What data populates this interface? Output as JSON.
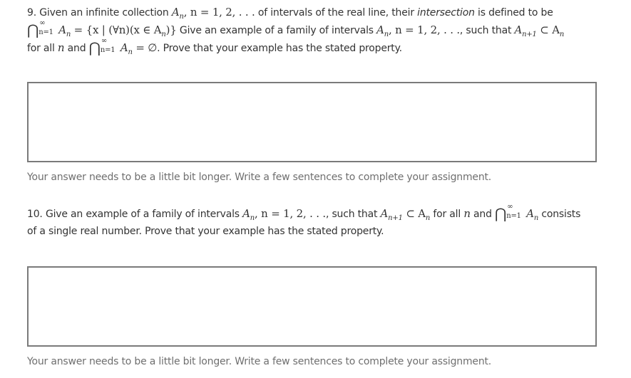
{
  "questions": [
    {
      "number": "9.",
      "text": {
        "p1": "Given an infinite collection ",
        "p2": " of intervals of the real line, their ",
        "p2_emph": "intersection",
        "p3": " is defined to be",
        "p4": " Give an example of a family of intervals ",
        "p5": ", such that ",
        "p6": "for all ",
        "p7": " and ",
        "p8": ". Prove that your example has the stated property."
      },
      "math": {
        "A": "A",
        "n": "n",
        "seq": ", n = 1, 2, . . .",
        "seq2": ", n = 1, 2, . . .",
        "cap": "⋂",
        "sup": "∞",
        "sub": "n=1",
        "eq_def": " = {x | (∀n)(x ∈ A",
        "eq_def_end": ")}",
        "subset": " ⊂ A",
        "sub_n1": "n+1",
        "eq_empty": " = ∅"
      },
      "answer_value": "",
      "hint": "Your answer needs to be a little bit longer. Write a few sentences to complete your assignment."
    },
    {
      "number": "10.",
      "text": {
        "p1": "Give an example of a family of intervals ",
        "p2": ", such that ",
        "p3": " for all ",
        "p4": " and ",
        "p5": " consists",
        "p6": "of a single real number. Prove that your example has the stated property."
      },
      "answer_value": "",
      "hint": "Your answer needs to be a little bit longer. Write a few sentences to complete your assignment."
    }
  ]
}
